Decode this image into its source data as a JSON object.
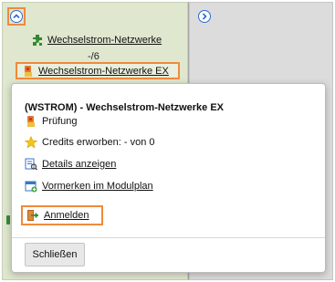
{
  "tree": {
    "node_title": "Wechselstrom-Netzwerke",
    "node_count": "-/6",
    "selected_node": "Wechselstrom-Netzwerke EX"
  },
  "popup": {
    "title": "(WSTROM) - Wechselstrom-Netzwerke EX",
    "exam_label": "Prüfung",
    "credits_label": "Credits erworben: - von 0",
    "details_link": "Details anzeigen",
    "bookmark_link": "Vormerken im Modulplan",
    "register_link": "Anmelden",
    "close_button": "Schließen"
  },
  "colors": {
    "highlight": "#f08a3c",
    "accent_blue": "#2a6ad0",
    "left_column_bg": "#dfe7cf",
    "right_column_bg": "#dcdcdc"
  }
}
